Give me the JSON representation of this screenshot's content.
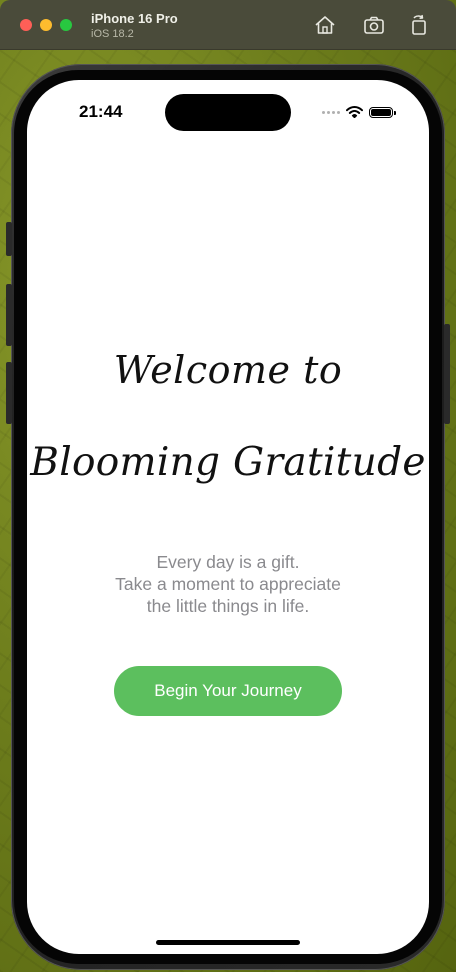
{
  "simulator": {
    "device_name": "iPhone 16 Pro",
    "os_version": "iOS 18.2",
    "buttons": [
      {
        "name": "home",
        "icon": "home-icon"
      },
      {
        "name": "screenshot",
        "icon": "camera-icon"
      },
      {
        "name": "rotate",
        "icon": "rotate-icon"
      }
    ]
  },
  "status_bar": {
    "time": "21:44",
    "icons": [
      "signal-dots-icon",
      "wifi-icon",
      "battery-icon"
    ]
  },
  "welcome": {
    "line1": "Welcome to",
    "line2": "Blooming Gratitude"
  },
  "subtitle": {
    "lines": [
      "Every day is a gift.",
      "Take a moment to appreciate",
      "the little things in life."
    ]
  },
  "cta": {
    "label": "Begin Your Journey"
  },
  "colors": {
    "accent": "#5cbf5e",
    "subtitle_text": "#8a8a8e",
    "screen_bg": "#ffffff"
  }
}
